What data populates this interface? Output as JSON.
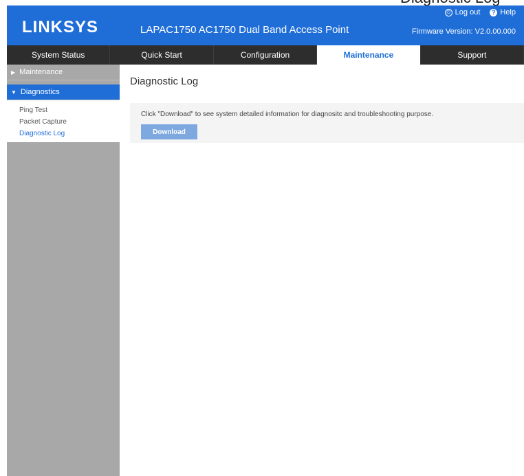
{
  "overflow_caption": "Diagnostic Log",
  "header": {
    "logo": "LINKSYS",
    "product": "LAPAC1750 AC1750 Dual Band Access Point",
    "logout": "Log out",
    "help": "Help",
    "firmware": "Firmware Version: V2.0.00.000",
    "bg_color": "#1f6ed8"
  },
  "nav": {
    "tabs": [
      "System Status",
      "Quick Start",
      "Configuration",
      "Maintenance",
      "Support"
    ],
    "active": "Maintenance"
  },
  "sidebar": {
    "groups": [
      {
        "label": "Maintenance",
        "expanded": false
      },
      {
        "label": "Diagnostics",
        "expanded": true
      }
    ],
    "items": [
      "Ping Test",
      "Packet Capture",
      "Diagnostic Log"
    ],
    "active_item": "Diagnostic Log"
  },
  "main": {
    "title": "Diagnostic Log",
    "description": "Click \"Download\" to see system detailed information for diagnositc and troubleshooting purpose.",
    "download_label": "Download"
  }
}
